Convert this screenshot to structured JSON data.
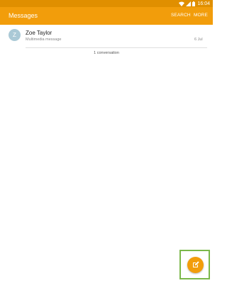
{
  "status_bar": {
    "time": "16:04"
  },
  "app_bar": {
    "title": "Messages",
    "search_label": "SEARCH",
    "more_label": "MORE"
  },
  "conversations": [
    {
      "avatar_letter": "Z",
      "name": "Zoe Taylor",
      "preview": "Multimedia message",
      "date": "6 Jul"
    }
  ],
  "conversation_count": "1 conversation",
  "icons": {
    "wifi": "wifi-icon",
    "signal": "signal-icon",
    "battery": "battery-icon",
    "compose": "compose-icon"
  },
  "colors": {
    "app_bar": "#f29d0b",
    "status_bar": "#e08f00",
    "avatar": "#aac9d6",
    "highlight": "#7bb84a"
  }
}
